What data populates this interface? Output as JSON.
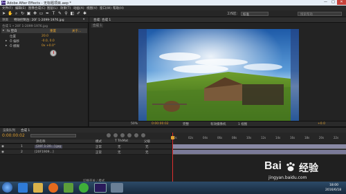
{
  "window": {
    "title": "Adobe After Effects - 无标题项目.aep *",
    "min": "—",
    "max": "□",
    "close": "✕"
  },
  "menu": [
    "文件(F)",
    "编辑(E)",
    "图像合成(C)",
    "图层(L)",
    "效果(T)",
    "动画(A)",
    "视图(V)",
    "窗口(W)",
    "帮助(H)"
  ],
  "toolbar": {
    "workspace_label": "工作区:",
    "workspace_value": "标准",
    "search_placeholder": "搜索帮助"
  },
  "left_panel": {
    "tab1": "项目",
    "tab2": "特效控制台: 20F 1-2099-1976.jpg",
    "tab3": "▾",
    "header": "合成 1 • 20F 1-2099-1976.jpg",
    "rows": [
      {
        "expand": "▸",
        "label": "fx 空白",
        "value": "重置",
        "extra": "关于..."
      },
      {
        "expand": "",
        "label": "位置",
        "value": "20.0",
        "extra": ""
      },
      {
        "expand": "▸",
        "label": "Ŏ 偏移",
        "value": "-0.0, 0.0",
        "extra": ""
      },
      {
        "expand": "▸",
        "label": "Ŏ 模糊",
        "value": "0x +0.0°",
        "extra": ""
      }
    ]
  },
  "comp_panel": {
    "tab": "合成: 合成 1",
    "sub_tab": "合成 1",
    "bottom": {
      "zoom": "50%",
      "time": "0:00:00:02",
      "quality": "完整",
      "camera": "有效摄像机",
      "view": "1 视图",
      "offset": "+0.0"
    }
  },
  "timeline": {
    "tab_render": "渲染队列",
    "tab_comp": "合成 1",
    "timecode": "0:00:00:02",
    "col_source": "源名称",
    "col_mode": "模式",
    "col_trkmat": "T TrkMat",
    "col_parent": "父级",
    "layers": [
      {
        "num": "1",
        "name": "[20F 1-20...].jpg",
        "mode": "正常",
        "trk": "无",
        "parent": "无"
      },
      {
        "num": "2",
        "name": "[20F1909...]",
        "mode": "正常",
        "trk": "无",
        "parent": "无"
      }
    ],
    "ruler_ticks": [
      "0s",
      "02s",
      "04s",
      "06s",
      "08s",
      "10s",
      "12s",
      "14s",
      "16s",
      "18s",
      "20s",
      "22s"
    ],
    "bottom_label": "切换开关 / 模式"
  },
  "taskbar": {
    "time": "18:00",
    "date": "2016/6/18"
  },
  "watermark": {
    "brand1": "Bai",
    "brand2": "经验",
    "url": "jingyan.baidu.com"
  },
  "colors": {
    "accent_orange": "#e0a030",
    "layer_bar": "#8a8aa6",
    "playhead": "#e03030"
  }
}
